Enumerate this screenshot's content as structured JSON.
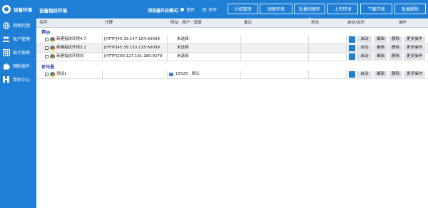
{
  "app": {
    "name": "设备环境"
  },
  "sidebar": {
    "items": [
      {
        "icon": "globe-icon",
        "label": "网络代理"
      },
      {
        "icon": "users-icon",
        "label": "账户管理"
      },
      {
        "icon": "table-icon",
        "label": "统计表格"
      },
      {
        "icon": "puzzle-icon",
        "label": "辅助插件"
      },
      {
        "icon": "h-icon",
        "label": "帮助中心"
      }
    ]
  },
  "topbar": {
    "title": "设备指纹环境",
    "mode_label": "浏览器开启模式：",
    "mode_single": "单开",
    "mode_multi": "多开",
    "selected_mode": "单开",
    "buttons": [
      "分组管理",
      "创建环境",
      "批量创建环境",
      "上传环境",
      "下载环境",
      "批量删除"
    ]
  },
  "table": {
    "headers": [
      "名称",
      "代理",
      "网站 - 账户 - 国家",
      "备注",
      "状态",
      "启动/关闭",
      "操作"
    ],
    "groups": [
      {
        "label": "美ip",
        "rows": [
          {
            "name": "新建指纹环境4.7",
            "proxy": "[HTTP]45.39.147.164:60099",
            "site": "未选择"
          },
          {
            "name": "新建指纹环境3.2",
            "proxy": "[HTTP]45.39.153.115:60099",
            "site": "未选择"
          },
          {
            "name": "新建指纹环境白",
            "proxy": "[HTTP]209.127.191.180:9279",
            "site": "未选择"
          }
        ]
      },
      {
        "label": "亚马逊",
        "rows": [
          {
            "name": "测试1",
            "proxy": "",
            "site": "15525 - 默认"
          }
        ]
      }
    ],
    "row_actions": [
      "启动",
      "编辑",
      "删除",
      "更多操作"
    ]
  },
  "colors": {
    "primary": "#1f7fd4",
    "header_bg": "#e8edf3",
    "row_alt": "#f0f0f0",
    "group_text": "#163b9c"
  }
}
